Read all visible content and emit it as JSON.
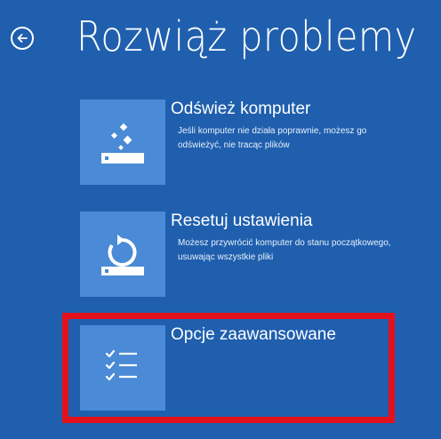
{
  "header": {
    "title": "Rozwiąż problemy"
  },
  "options": [
    {
      "title": "Odśwież komputer",
      "description": "Jeśli komputer nie działa poprawnie, możesz go odświeżyć, nie tracąc plików",
      "icon": "refresh-sparkle-icon"
    },
    {
      "title": "Resetuj ustawienia",
      "description": "Możesz przywrócić komputer do stanu początkowego, usuwając wszystkie pliki",
      "icon": "reset-circular-arrow-icon"
    },
    {
      "title": "Opcje zaawansowane",
      "description": "",
      "icon": "checklist-icon"
    }
  ],
  "colors": {
    "background": "#1f5fae",
    "tile": "#4a8ad6",
    "highlight": "#e3111b"
  }
}
